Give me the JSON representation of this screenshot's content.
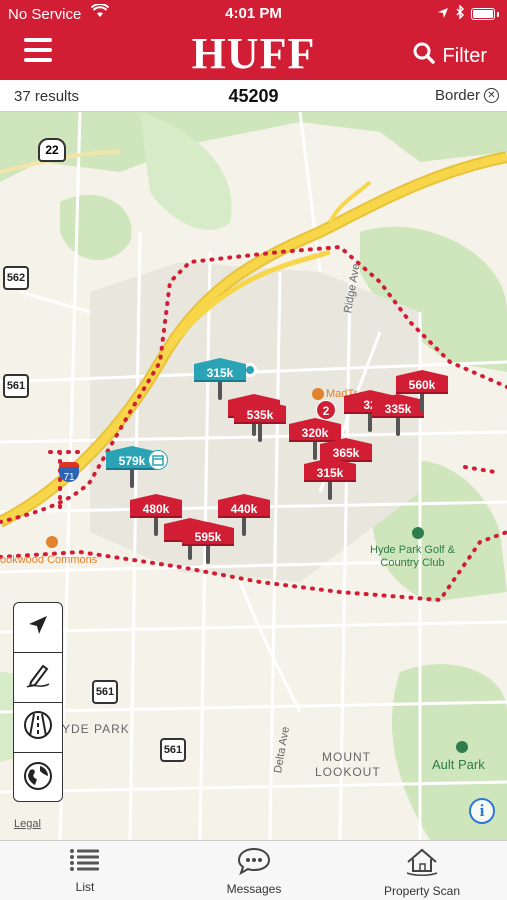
{
  "status_bar": {
    "carrier": "No Service",
    "time": "4:01 PM"
  },
  "header": {
    "logo": "HUFF",
    "filter_label": "Filter"
  },
  "results_bar": {
    "count": "37 results",
    "zip": "45209",
    "border_label": "Border"
  },
  "map": {
    "labels": {
      "ridge_ave": "Ridge Ave",
      "delta_ave": "Delta Ave",
      "hyde_park": "YDE PARK",
      "mount_lookout_1": "MOUNT",
      "mount_lookout_2": "LOOKOUT",
      "hyde_park_golf": "Hyde Park Golf &",
      "country_club": "Country Club",
      "ault_park": "Ault Park",
      "rookwood": "ookwood Commons",
      "mad_tree": "MadTr"
    },
    "shields": {
      "us22": "22",
      "r562": "562",
      "r561a": "561",
      "r561b": "561",
      "r561c": "561",
      "i71": "71"
    },
    "pins": [
      {
        "label": "315k",
        "color": "teal"
      },
      {
        "label": "579k",
        "color": "teal"
      },
      {
        "label": "535k",
        "color": "red"
      },
      {
        "label": "320k",
        "color": "red"
      },
      {
        "label": "365k",
        "color": "red"
      },
      {
        "label": "315k",
        "color": "red"
      },
      {
        "label": "32",
        "color": "red"
      },
      {
        "label": "335k",
        "color": "red"
      },
      {
        "label": "560k",
        "color": "red"
      },
      {
        "label": "480k",
        "color": "red"
      },
      {
        "label": "440k",
        "color": "red"
      },
      {
        "label": "3",
        "color": "red"
      },
      {
        "label": "595k",
        "color": "red"
      }
    ],
    "cluster_count": "2",
    "legal": "Legal",
    "colors": {
      "brand_red": "#d21e35",
      "teal": "#2aa3b6",
      "highway": "#f7d64a"
    }
  },
  "tabs": [
    {
      "label": "List",
      "icon": "list-icon"
    },
    {
      "label": "Messages",
      "icon": "chat-bubble-icon"
    },
    {
      "label": "Property Scan",
      "icon": "house-scan-icon"
    }
  ]
}
